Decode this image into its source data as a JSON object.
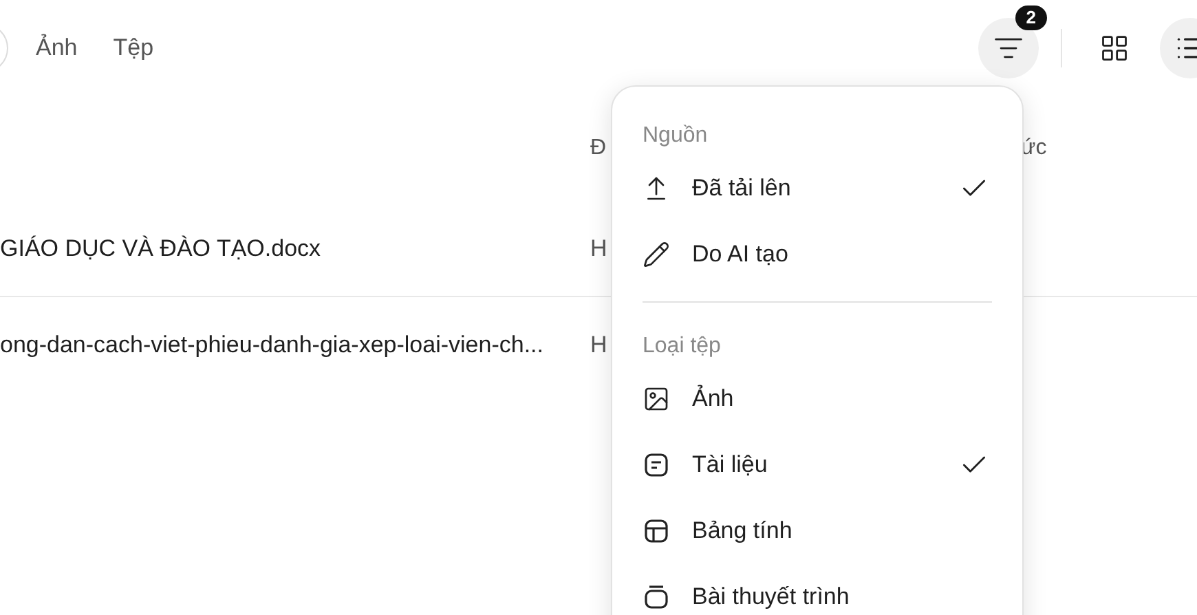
{
  "tabs": [
    {
      "label": "Ảnh",
      "selected": false
    },
    {
      "label": "Tệp",
      "selected": false
    }
  ],
  "toolbar": {
    "filter_count": "2",
    "views": [
      {
        "kind": "grid",
        "selected": false
      },
      {
        "kind": "list",
        "selected": true
      }
    ]
  },
  "table": {
    "columns": [
      "Đ",
      "ức"
    ],
    "rows": [
      {
        "name": "GIÁO DỤC VÀ ĐÀO TẠO.docx",
        "column_2": "H"
      },
      {
        "name": "ong-dan-cach-viet-phieu-danh-gia-xep-loai-vien-ch...",
        "column_2": "H"
      }
    ]
  },
  "filter_menu": {
    "sections": [
      {
        "title": "Nguồn",
        "items": [
          {
            "kind": "upload",
            "label": "Đã tải lên",
            "checked": true
          },
          {
            "kind": "ai",
            "label": "Do AI tạo",
            "checked": false
          }
        ]
      },
      {
        "title": "Loại tệp",
        "items": [
          {
            "kind": "image",
            "label": "Ảnh",
            "checked": false
          },
          {
            "kind": "document",
            "label": "Tài liệu",
            "checked": true
          },
          {
            "kind": "spreadsheet",
            "label": "Bảng tính",
            "checked": false
          },
          {
            "kind": "presentation",
            "label": "Bài thuyết trình",
            "checked": false
          }
        ]
      }
    ]
  }
}
